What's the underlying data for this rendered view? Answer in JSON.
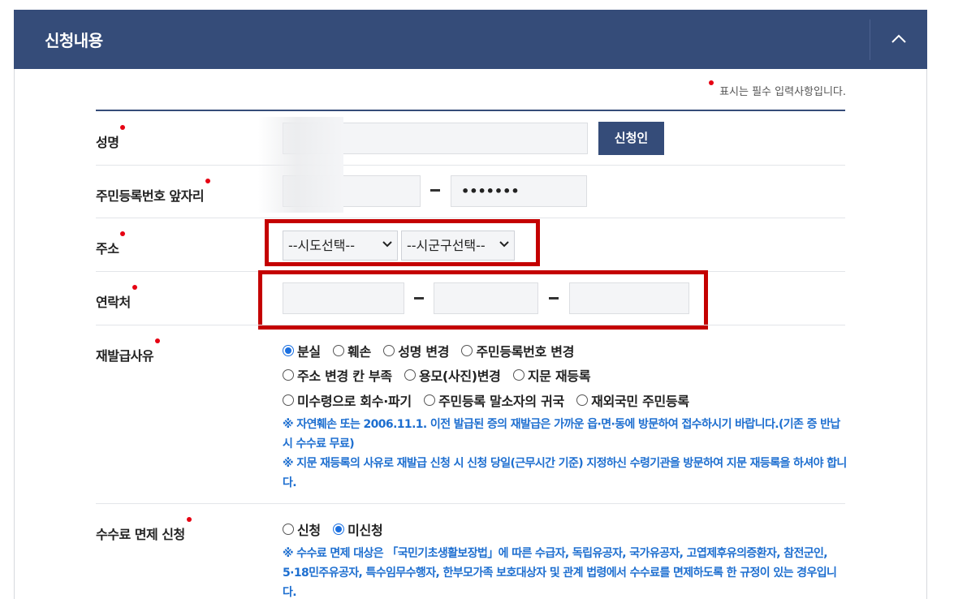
{
  "panel": {
    "title": "신청내용"
  },
  "required_note": "표시는 필수 입력사항입니다.",
  "name": {
    "label": "성명",
    "button": "신청인"
  },
  "rrn": {
    "label": "주민등록번호 앞자리",
    "back_value": "•••••••"
  },
  "address": {
    "label": "주소",
    "sido": "--시도선택--",
    "sigungu": "--시군구선택--"
  },
  "phone": {
    "label": "연락처",
    "part1": "",
    "part2": "",
    "part3": ""
  },
  "reason": {
    "label": "재발급사유",
    "options": [
      "분실",
      "훼손",
      "성명 변경",
      "주민등록번호 변경",
      "주소 변경 칸 부족",
      "용모(사진)변경",
      "지문 재등록",
      "미수령으로 회수·파기",
      "주민등록 말소자의 귀국",
      "재외국민 주민등록"
    ],
    "selected": "분실",
    "note1": "※ 자연훼손 또는 2006.11.1. 이전 발급된 증의 재발급은 가까운 읍·면·동에 방문하여 접수하시기 바랍니다.(기존 증 반납시 수수료 무료)",
    "note2": "※ 지문 재등록의 사유로 재발급 신청 시 신청 당일(근무시간 기준) 지정하신 수령기관을 방문하여 지문 재등록을 하셔야 합니다."
  },
  "fee": {
    "label": "수수료 면제 신청",
    "options": [
      "신청",
      "미신청"
    ],
    "selected": "미신청",
    "note": "※ 수수료 면제 대상은 「국민기초생활보장법」에 따른 수급자, 독립유공자, 국가유공자, 고엽제후유의증환자, 참전군인, 5·18민주유공자, 특수임무수행자, 한부모가족 보호대상자 및 관계 법령에서 수수료를 면제하도록 한 규정이 있는 경우입니다."
  },
  "colors": {
    "header": "#354c79",
    "required": "#e60012",
    "note": "#1e6fd0",
    "highlight": "#c40000"
  }
}
